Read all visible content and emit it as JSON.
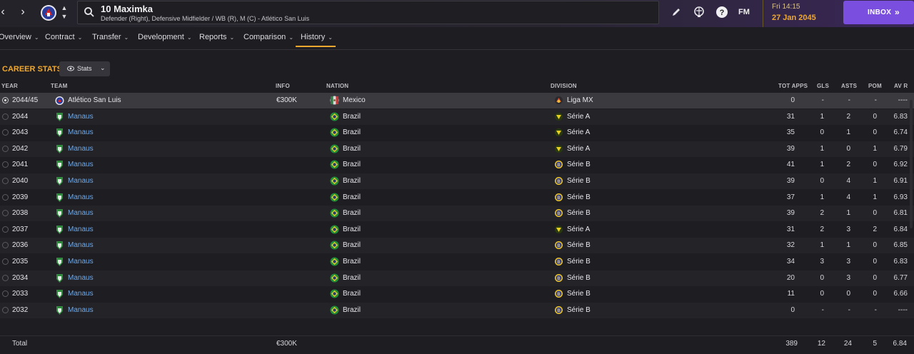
{
  "header": {
    "player_name": "10 Maximka",
    "player_desc": "Defender (Right), Defensive Midfielder / WB (R), M (C) - Atlético San Luis",
    "date_time": "Fri 14:15",
    "date_day": "27 Jan 2045",
    "inbox_label": "INBOX",
    "fm_label": "FM"
  },
  "tabs": [
    {
      "label": "Overview"
    },
    {
      "label": "Contract"
    },
    {
      "label": "Transfer"
    },
    {
      "label": "Development"
    },
    {
      "label": "Reports"
    },
    {
      "label": "Comparison"
    },
    {
      "label": "History"
    }
  ],
  "section": {
    "title": "CAREER STATS",
    "stats_button": "Stats"
  },
  "columns": {
    "year": "YEAR",
    "team": "TEAM",
    "info": "INFO",
    "nation": "NATION",
    "division": "DIVISION",
    "apps": "TOT APPS",
    "gls": "GLS",
    "asts": "ASTS",
    "pom": "POM",
    "avr": "AV R"
  },
  "rows": [
    {
      "year": "2044/45",
      "team": "Atlético San Luis",
      "info": "€300K",
      "nation": "Mexico",
      "division": "Liga MX",
      "apps": "0",
      "gls": "-",
      "asts": "-",
      "pom": "-",
      "avr": "----"
    },
    {
      "year": "2044",
      "team": "Manaus",
      "info": "",
      "nation": "Brazil",
      "division": "Série A",
      "apps": "31",
      "gls": "1",
      "asts": "2",
      "pom": "0",
      "avr": "6.83"
    },
    {
      "year": "2043",
      "team": "Manaus",
      "info": "",
      "nation": "Brazil",
      "division": "Série A",
      "apps": "35",
      "gls": "0",
      "asts": "1",
      "pom": "0",
      "avr": "6.74"
    },
    {
      "year": "2042",
      "team": "Manaus",
      "info": "",
      "nation": "Brazil",
      "division": "Série A",
      "apps": "39",
      "gls": "1",
      "asts": "0",
      "pom": "1",
      "avr": "6.79"
    },
    {
      "year": "2041",
      "team": "Manaus",
      "info": "",
      "nation": "Brazil",
      "division": "Série B",
      "apps": "41",
      "gls": "1",
      "asts": "2",
      "pom": "0",
      "avr": "6.92"
    },
    {
      "year": "2040",
      "team": "Manaus",
      "info": "",
      "nation": "Brazil",
      "division": "Série B",
      "apps": "39",
      "gls": "0",
      "asts": "4",
      "pom": "1",
      "avr": "6.91"
    },
    {
      "year": "2039",
      "team": "Manaus",
      "info": "",
      "nation": "Brazil",
      "division": "Série B",
      "apps": "37",
      "gls": "1",
      "asts": "4",
      "pom": "1",
      "avr": "6.93"
    },
    {
      "year": "2038",
      "team": "Manaus",
      "info": "",
      "nation": "Brazil",
      "division": "Série B",
      "apps": "39",
      "gls": "2",
      "asts": "1",
      "pom": "0",
      "avr": "6.81"
    },
    {
      "year": "2037",
      "team": "Manaus",
      "info": "",
      "nation": "Brazil",
      "division": "Série A",
      "apps": "31",
      "gls": "2",
      "asts": "3",
      "pom": "2",
      "avr": "6.84"
    },
    {
      "year": "2036",
      "team": "Manaus",
      "info": "",
      "nation": "Brazil",
      "division": "Série B",
      "apps": "32",
      "gls": "1",
      "asts": "1",
      "pom": "0",
      "avr": "6.85"
    },
    {
      "year": "2035",
      "team": "Manaus",
      "info": "",
      "nation": "Brazil",
      "division": "Série B",
      "apps": "34",
      "gls": "3",
      "asts": "3",
      "pom": "0",
      "avr": "6.83"
    },
    {
      "year": "2034",
      "team": "Manaus",
      "info": "",
      "nation": "Brazil",
      "division": "Série B",
      "apps": "20",
      "gls": "0",
      "asts": "3",
      "pom": "0",
      "avr": "6.77"
    },
    {
      "year": "2033",
      "team": "Manaus",
      "info": "",
      "nation": "Brazil",
      "division": "Série B",
      "apps": "11",
      "gls": "0",
      "asts": "0",
      "pom": "0",
      "avr": "6.66"
    },
    {
      "year": "2032",
      "team": "Manaus",
      "info": "",
      "nation": "Brazil",
      "division": "Série B",
      "apps": "0",
      "gls": "-",
      "asts": "-",
      "pom": "-",
      "avr": "----"
    }
  ],
  "total": {
    "label": "Total",
    "info": "€300K",
    "apps": "389",
    "gls": "12",
    "asts": "24",
    "pom": "5",
    "avr": "6.84"
  },
  "colors": {
    "accent": "#f0a830",
    "link": "#6fa8e8",
    "inbox": "#7a4fe0"
  }
}
